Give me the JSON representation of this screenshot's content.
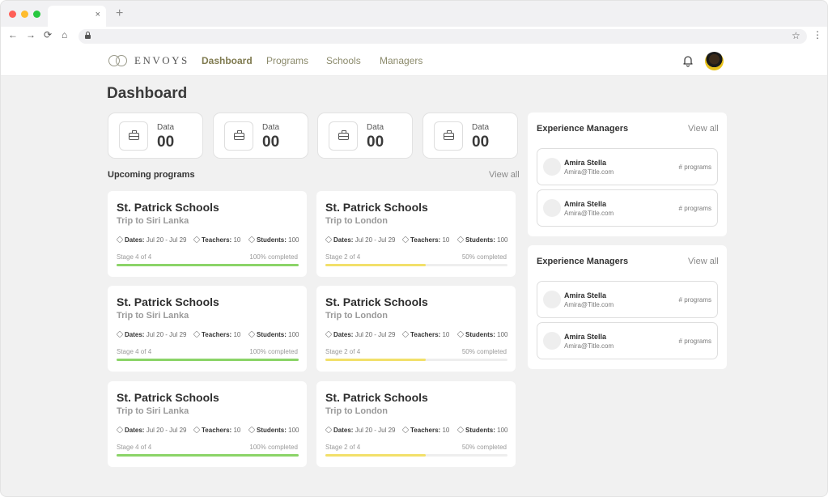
{
  "browser": {
    "tab_close": "×",
    "new_tab": "+",
    "nav": {
      "back": "←",
      "forward": "→",
      "reload": "⟳",
      "home": "⌂"
    },
    "bookmark": "☆",
    "menu": "⋮",
    "dot_colors": [
      "#ff5f57",
      "#febc2e",
      "#28c840"
    ]
  },
  "header": {
    "logo_text": "ENVOYS",
    "nav": [
      {
        "label": "Dashboard",
        "active": true
      },
      {
        "label": "Programs",
        "active": false
      },
      {
        "label": "Schools",
        "active": false
      },
      {
        "label": "Managers",
        "active": false
      }
    ],
    "accent_color": "#7f7a4f"
  },
  "page_title": "Dashboard",
  "stats": [
    {
      "label": "Data",
      "value": "00",
      "icon": "briefcase-icon"
    },
    {
      "label": "Data",
      "value": "00",
      "icon": "briefcase-icon"
    },
    {
      "label": "Data",
      "value": "00",
      "icon": "briefcase-icon"
    },
    {
      "label": "Data",
      "value": "00",
      "icon": "briefcase-icon"
    }
  ],
  "upcoming": {
    "title": "Upcoming programs",
    "view_all": "View all",
    "programs": [
      {
        "school": "St. Patrick Schools",
        "trip": "Trip to Siri Lanka",
        "dates_label": "Dates:",
        "dates": "Jul 20 - Jul 29",
        "teachers_label": "Teachers:",
        "teachers": "10",
        "students_label": "Students:",
        "students": "100",
        "stage": "Stage 4 of 4",
        "completed": "100% completed",
        "progress": 1.0,
        "color": "#8bd468"
      },
      {
        "school": "St. Patrick Schools",
        "trip": "Trip to London",
        "dates_label": "Dates:",
        "dates": "Jul 20 - Jul 29",
        "teachers_label": "Teachers:",
        "teachers": "10",
        "students_label": "Students:",
        "students": "100",
        "stage": "Stage 2 of 4",
        "completed": "50% completed",
        "progress": 0.55,
        "color": "#f2e06a"
      },
      {
        "school": "St. Patrick Schools",
        "trip": "Trip to Siri Lanka",
        "dates_label": "Dates:",
        "dates": "Jul 20 - Jul 29",
        "teachers_label": "Teachers:",
        "teachers": "10",
        "students_label": "Students:",
        "students": "100",
        "stage": "Stage 4 of 4",
        "completed": "100% completed",
        "progress": 1.0,
        "color": "#8bd468"
      },
      {
        "school": "St. Patrick Schools",
        "trip": "Trip to London",
        "dates_label": "Dates:",
        "dates": "Jul 20 - Jul 29",
        "teachers_label": "Teachers:",
        "teachers": "10",
        "students_label": "Students:",
        "students": "100",
        "stage": "Stage 2 of 4",
        "completed": "50% completed",
        "progress": 0.55,
        "color": "#f2e06a"
      },
      {
        "school": "St. Patrick Schools",
        "trip": "Trip to Siri Lanka",
        "dates_label": "Dates:",
        "dates": "Jul 20 - Jul 29",
        "teachers_label": "Teachers:",
        "teachers": "10",
        "students_label": "Students:",
        "students": "100",
        "stage": "Stage 4 of 4",
        "completed": "100% completed",
        "progress": 1.0,
        "color": "#8bd468"
      },
      {
        "school": "St. Patrick Schools",
        "trip": "Trip to London",
        "dates_label": "Dates:",
        "dates": "Jul 20 - Jul 29",
        "teachers_label": "Teachers:",
        "teachers": "10",
        "students_label": "Students:",
        "students": "100",
        "stage": "Stage 2 of 4",
        "completed": "50% completed",
        "progress": 0.55,
        "color": "#f2e06a"
      }
    ]
  },
  "manager_panels": [
    {
      "title": "Experience Managers",
      "view_all": "View all",
      "items": [
        {
          "name": "Amira Stella",
          "email": "Amira@Title.com",
          "count": "# programs"
        },
        {
          "name": "Amira Stella",
          "email": "Amira@Title.com",
          "count": "# programs"
        }
      ]
    },
    {
      "title": "Experience Managers",
      "view_all": "View all",
      "items": [
        {
          "name": "Amira Stella",
          "email": "Amira@Title.com",
          "count": "# programs"
        },
        {
          "name": "Amira Stella",
          "email": "Amira@Title.com",
          "count": "# programs"
        }
      ]
    }
  ]
}
